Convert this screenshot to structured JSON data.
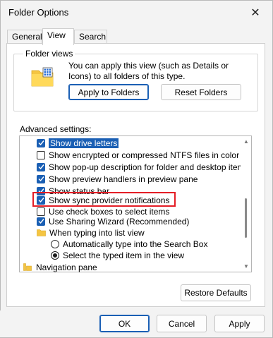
{
  "window": {
    "title": "Folder Options",
    "close_glyph": "✕"
  },
  "tabs": [
    {
      "label": "General",
      "active": false
    },
    {
      "label": "View",
      "active": true
    },
    {
      "label": "Search",
      "active": false
    }
  ],
  "folder_views": {
    "label": "Folder views",
    "description": "You can apply this view (such as Details or Icons) to all folders of this type.",
    "apply_button": "Apply to Folders",
    "reset_button": "Reset Folders",
    "icon": "folder-grid-icon"
  },
  "advanced": {
    "label": "Advanced settings:",
    "items": [
      {
        "type": "checkbox",
        "checked": true,
        "label": "Show drive letters",
        "selected": true
      },
      {
        "type": "checkbox",
        "checked": false,
        "label": "Show encrypted or compressed NTFS files in color"
      },
      {
        "type": "checkbox",
        "checked": true,
        "label": "Show pop-up description for folder and desktop items"
      },
      {
        "type": "checkbox",
        "checked": true,
        "label": "Show preview handlers in preview pane"
      },
      {
        "type": "checkbox",
        "checked": true,
        "label": "Show status bar"
      },
      {
        "type": "checkbox",
        "checked": true,
        "label": "Show sync provider notifications",
        "highlighted": true
      },
      {
        "type": "checkbox",
        "checked": false,
        "label": "Use check boxes to select items"
      },
      {
        "type": "checkbox",
        "checked": true,
        "label": "Use Sharing Wizard (Recommended)"
      },
      {
        "type": "folder",
        "label": "When typing into list view"
      },
      {
        "type": "radio",
        "checked": false,
        "label": "Automatically type into the Search Box"
      },
      {
        "type": "radio",
        "checked": true,
        "label": "Select the typed item in the view"
      },
      {
        "type": "nav",
        "label": "Navigation pane"
      }
    ]
  },
  "restore_button": "Restore Defaults",
  "footer": {
    "ok": "OK",
    "cancel": "Cancel",
    "apply": "Apply"
  },
  "colors": {
    "accent": "#1a5fb4",
    "highlight_box": "#e41e26"
  }
}
